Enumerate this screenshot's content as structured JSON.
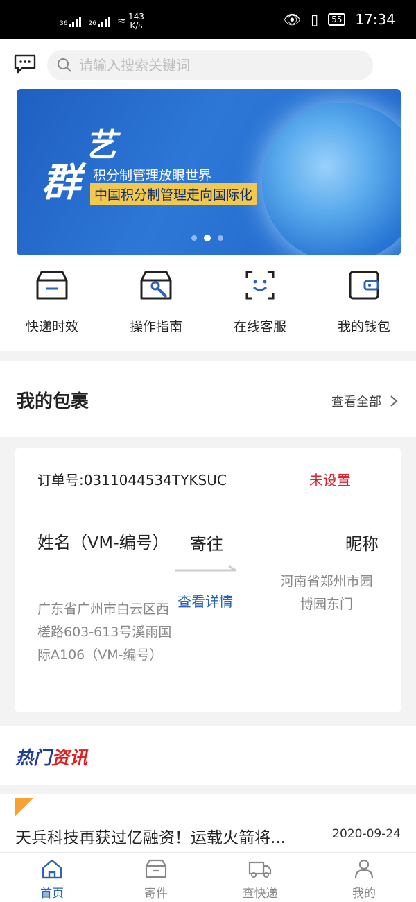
{
  "status_bar": {
    "signal1": "36",
    "signal2": "26",
    "speed_value": "143",
    "speed_unit": "K/s",
    "battery": "55",
    "time": "17:34"
  },
  "search": {
    "placeholder": "请输入搜索关键词"
  },
  "banner": {
    "logo_top": "艺",
    "logo_bottom": "群",
    "slogan1": "积分制管理放眼世界",
    "slogan2": "中国积分制管理走向国际化",
    "dots_total": 3,
    "dots_active": 2
  },
  "quick_links": [
    {
      "label": "快递时效",
      "icon": "box-icon"
    },
    {
      "label": "操作指南",
      "icon": "wrench-box-icon"
    },
    {
      "label": "在线客服",
      "icon": "smile-chat-icon"
    },
    {
      "label": "我的钱包",
      "icon": "wallet-icon"
    }
  ],
  "packages": {
    "title": "我的包裹",
    "view_all": "查看全部",
    "card": {
      "order": "订单号:0311044534TYKSUC",
      "status": "未设置",
      "sender_name": "姓名（VM-编号）",
      "sender_addr": "广东省广州市白云区西槎路603-613号溪雨国际A106（VM-编号）",
      "direction": "寄往",
      "detail": "查看详情",
      "receiver_name": "昵称",
      "receiver_addr": "河南省郑州市园博园东门"
    }
  },
  "hot": {
    "title_a": "热门",
    "title_b": "资讯"
  },
  "news": {
    "headline": "天兵科技再获过亿融资！运载火箭将...",
    "date": "2020-09-24"
  },
  "tabbar": {
    "home": "首页",
    "send": "寄件",
    "track": "查快递",
    "mine": "我的"
  },
  "colors": {
    "accent": "#2b63b5",
    "status_red": "#d7262d"
  }
}
